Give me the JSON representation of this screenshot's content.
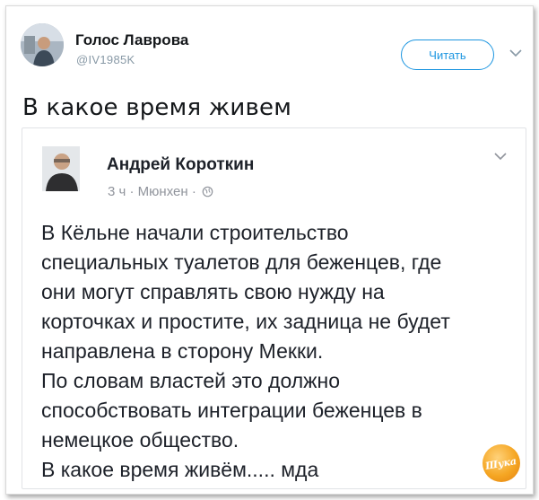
{
  "tweet": {
    "author_name": "Голос Лаврова",
    "handle": "@IV1985K",
    "follow_label": "Читать",
    "text": "В какое время живем"
  },
  "post": {
    "author_name": "Андрей Короткин",
    "time": "3 ч",
    "location": "Мюнхен",
    "separator": "·",
    "body_lines": [
      "В Кёльне начали строительство",
      "специальных туалетов для беженцев, где",
      "они могут справлять свою нужду на",
      "корточках и простите, их задница не будет",
      "направлена в сторону Мекки.",
      "По словам властей это должно",
      "способствовать интеграции беженцев в",
      "немецкое общество.",
      "В какое время живём..... мда"
    ]
  },
  "watermark": {
    "text": "Шука"
  },
  "colors": {
    "accent": "#1b95e0",
    "text": "#14171a",
    "muted": "#8899a6",
    "fb_text": "#1d2129",
    "fb_muted": "#90949c",
    "logo": "#f5a623"
  }
}
